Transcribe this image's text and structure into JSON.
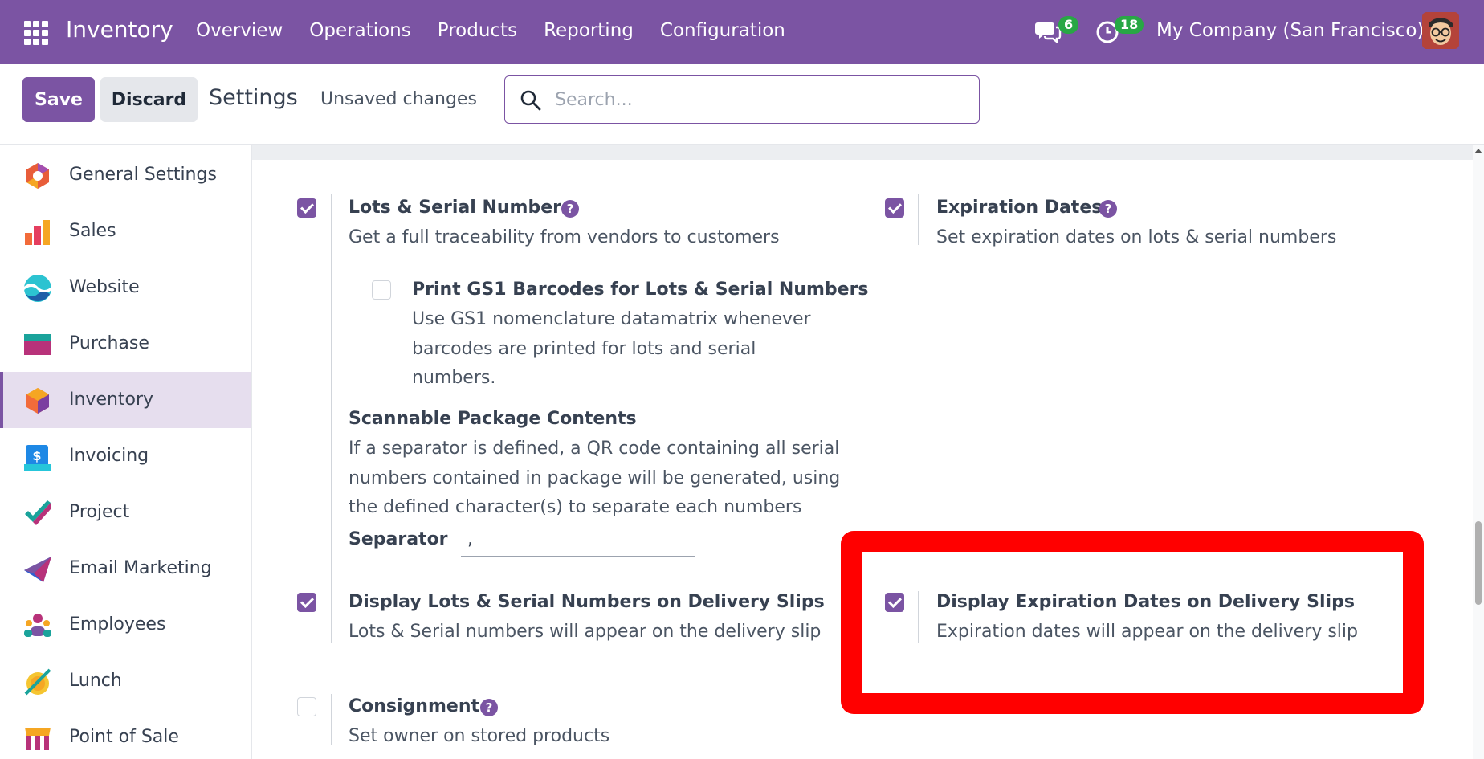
{
  "navbar": {
    "app_name": "Inventory",
    "menu": [
      "Overview",
      "Operations",
      "Products",
      "Reporting",
      "Configuration"
    ],
    "chat_count": "6",
    "activity_count": "18",
    "company": "My Company (San Francisco)"
  },
  "controls": {
    "save_label": "Save",
    "discard_label": "Discard",
    "breadcrumb": "Settings",
    "status": "Unsaved changes",
    "search_placeholder": "Search..."
  },
  "sidebar": {
    "items": [
      {
        "label": "General Settings",
        "icon": "general-settings-icon"
      },
      {
        "label": "Sales",
        "icon": "sales-icon"
      },
      {
        "label": "Website",
        "icon": "website-icon"
      },
      {
        "label": "Purchase",
        "icon": "purchase-icon"
      },
      {
        "label": "Inventory",
        "icon": "inventory-icon",
        "active": true
      },
      {
        "label": "Invoicing",
        "icon": "invoicing-icon"
      },
      {
        "label": "Project",
        "icon": "project-icon"
      },
      {
        "label": "Email Marketing",
        "icon": "email-marketing-icon"
      },
      {
        "label": "Employees",
        "icon": "employees-icon"
      },
      {
        "label": "Lunch",
        "icon": "lunch-icon"
      },
      {
        "label": "Point of Sale",
        "icon": "point-of-sale-icon"
      }
    ]
  },
  "settings": {
    "lots": {
      "title": "Lots & Serial Numbers",
      "desc": "Get a full traceability from vendors to customers",
      "checked": true
    },
    "gs1": {
      "title": "Print GS1 Barcodes for Lots & Serial Numbers",
      "desc1": "Use GS1 nomenclature datamatrix whenever",
      "desc2": "barcodes are printed for lots and serial",
      "desc3": "numbers.",
      "checked": false
    },
    "package": {
      "title": "Scannable Package Contents",
      "desc1": "If a separator is defined, a QR code containing all serial",
      "desc2": "numbers contained in package will be generated, using",
      "desc3": "the defined character(s) to separate each numbers"
    },
    "separator": {
      "label": "Separator",
      "value": ","
    },
    "display_lots": {
      "title": "Display Lots & Serial Numbers on Delivery Slips",
      "desc": "Lots & Serial numbers will appear on the delivery slip",
      "checked": true
    },
    "consignment": {
      "title": "Consignment",
      "desc": "Set owner on stored products",
      "checked": false
    },
    "expiration": {
      "title": "Expiration Dates",
      "desc": "Set expiration dates on lots & serial numbers",
      "checked": true
    },
    "display_expiration": {
      "title": "Display Expiration Dates on Delivery Slips",
      "desc": "Expiration dates will appear on the delivery slip",
      "checked": true
    }
  },
  "colors": {
    "brand": "#7b54a3",
    "highlight": "#ff0000",
    "badge": "#28a745"
  }
}
